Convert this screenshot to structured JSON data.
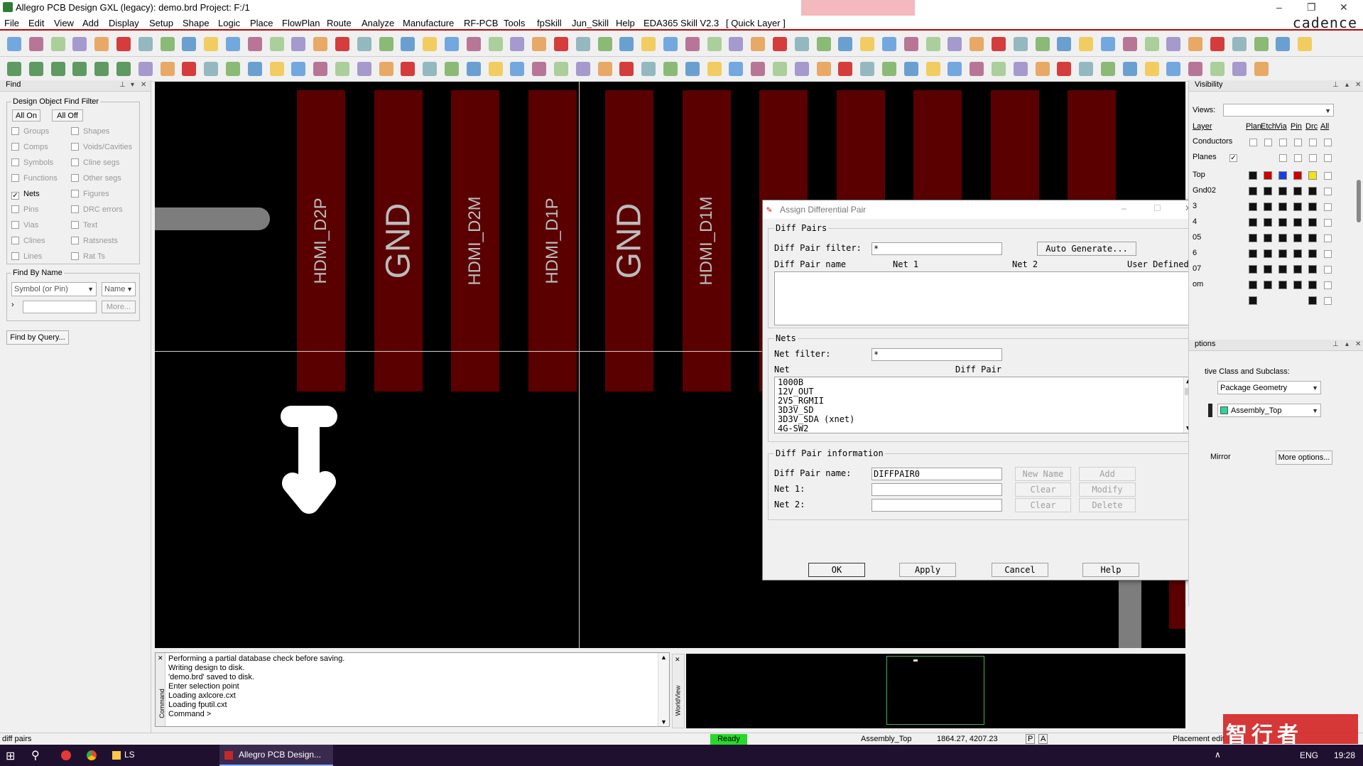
{
  "window": {
    "title": "Allegro PCB Design GXL (legacy): demo.brd  Project: F:/1",
    "brand": "cadence",
    "controls": [
      "–",
      "❐",
      "✕"
    ]
  },
  "menu": [
    "File",
    "Edit",
    "View",
    "Add",
    "Display",
    "Setup",
    "Shape",
    "Logic",
    "Place",
    "FlowPlan",
    "Route",
    "Analyze",
    "Manufacture",
    "RF-PCB",
    "Tools",
    "fpSkill",
    "Jun_Skill",
    "Help",
    "EDA365 Skill V2.3",
    "[ Quick Layer ]"
  ],
  "find_panel": {
    "header": "Find",
    "filter_title": "Design Object Find Filter",
    "all_on": "All On",
    "all_off": "All Off",
    "left_items": [
      {
        "label": "Groups",
        "checked": false
      },
      {
        "label": "Comps",
        "checked": false
      },
      {
        "label": "Symbols",
        "checked": false
      },
      {
        "label": "Functions",
        "checked": false
      },
      {
        "label": "Nets",
        "checked": true
      },
      {
        "label": "Pins",
        "checked": false
      },
      {
        "label": "Vias",
        "checked": false
      },
      {
        "label": "Clines",
        "checked": false
      },
      {
        "label": "Lines",
        "checked": false
      }
    ],
    "right_items": [
      {
        "label": "Shapes",
        "checked": false
      },
      {
        "label": "Voids/Cavities",
        "checked": false
      },
      {
        "label": "Cline segs",
        "checked": false
      },
      {
        "label": "Other segs",
        "checked": false
      },
      {
        "label": "Figures",
        "checked": false
      },
      {
        "label": "DRC errors",
        "checked": false
      },
      {
        "label": "Text",
        "checked": false
      },
      {
        "label": "Ratsnests",
        "checked": false
      },
      {
        "label": "Rat Ts",
        "checked": false
      }
    ],
    "find_by_name_title": "Find By Name",
    "type_combo": "Symbol (or Pin)",
    "name_combo": "Name",
    "more_button": "More...",
    "query_button": "Find by Query..."
  },
  "canvas": {
    "pads": [
      {
        "label": "HDMI_D2P",
        "big": false
      },
      {
        "label": "GND",
        "big": true
      },
      {
        "label": "HDMI_D2M",
        "big": false
      },
      {
        "label": "HDMI_D1P",
        "big": false
      },
      {
        "label": "GND",
        "big": true
      },
      {
        "label": "HDMI_D1M",
        "big": false
      },
      {
        "label": "",
        "big": false
      },
      {
        "label": "",
        "big": false
      },
      {
        "label": "",
        "big": false
      },
      {
        "label": "",
        "big": false
      },
      {
        "label": "",
        "big": false
      }
    ]
  },
  "dialog": {
    "title": "Assign Differential Pair",
    "diff_pairs_title": "Diff Pairs",
    "diff_pair_filter_label": "Diff Pair filter:",
    "diff_pair_filter_value": "*",
    "auto_generate": "Auto Generate...",
    "col_name": "Diff Pair name",
    "col_net1": "Net 1",
    "col_net2": "Net 2",
    "col_user": "User Defined",
    "nets_title": "Nets",
    "net_filter_label": "Net filter:",
    "net_filter_value": "*",
    "col_net": "Net",
    "col_diffpair": "Diff Pair",
    "nets": [
      "1000B",
      "12V_OUT",
      "2V5_RGMII",
      "3D3V_SD",
      "3D3V_SDA (xnet)",
      "4G-SW2"
    ],
    "info_title": "Diff Pair information",
    "name_label": "Diff Pair name:",
    "name_value": "DIFFPAIR0",
    "net1_label": "Net 1:",
    "net2_label": "Net 2:",
    "new_name": "New Name",
    "add": "Add",
    "clear1": "Clear",
    "modify": "Modify",
    "clear2": "Clear",
    "delete": "Delete",
    "ok": "OK",
    "apply": "Apply",
    "cancel": "Cancel",
    "help": "Help"
  },
  "visibility": {
    "header": "Visibility",
    "views_label": "Views:",
    "col_layer": "Layer",
    "cols": [
      "Plan",
      "Etch",
      "Via",
      "Pin",
      "Drc",
      "All"
    ],
    "conductors": "Conductors",
    "planes": "Planes",
    "layers": [
      "Top",
      "Gnd02",
      "3",
      "4",
      "05",
      "6",
      "07",
      "om",
      ""
    ],
    "options_header": "ptions",
    "active_class_label": "tive Class and Subclass:",
    "class_value": "Package Geometry",
    "subclass_value": "Assembly_Top",
    "mirror": "Mirror",
    "more_options": "More options..."
  },
  "command": {
    "lines": [
      "Performing a partial database check before saving.",
      "Writing design to disk.",
      "'demo.brd' saved to disk.",
      "Enter selection point",
      "Loading axlcore.cxt",
      "Loading fputil.cxt",
      "Command >"
    ],
    "side_label": "Command",
    "worldview_label": "WorldView"
  },
  "status": {
    "left": "diff pairs",
    "ready": "Ready",
    "subclass": "Assembly_Top",
    "coords": "1864.27, 4207.23",
    "p": "P",
    "a": "A",
    "mode": "Placement edit"
  },
  "taskbar": {
    "app1": "LS",
    "app2": "Allegro PCB Design...",
    "lang": "ENG",
    "time": "19:28"
  },
  "watermark": "智行者"
}
